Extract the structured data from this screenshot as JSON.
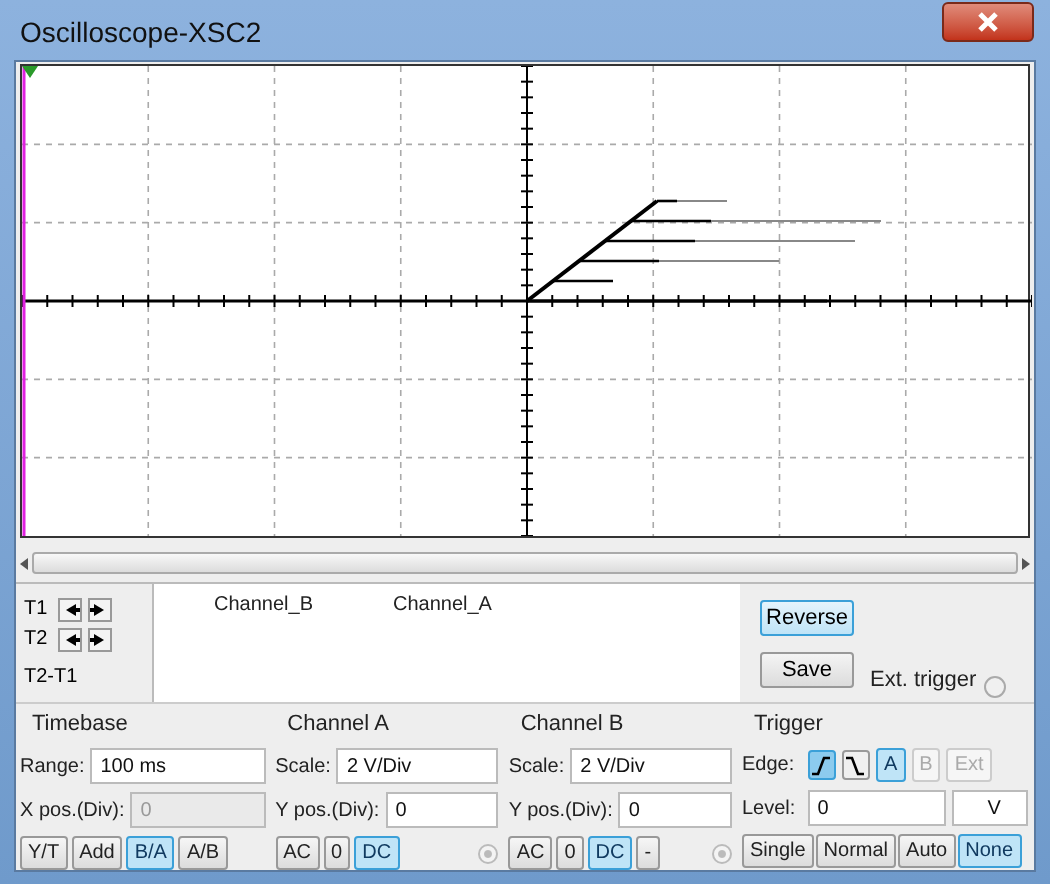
{
  "window": {
    "title": "Oscilloscope-XSC2"
  },
  "cursors": {
    "rows": [
      "T1",
      "T2",
      "T2-T1"
    ],
    "columns": [
      "Channel_B",
      "Channel_A"
    ]
  },
  "actions": [
    {
      "label": "Reverse",
      "selected": true
    },
    {
      "label": "Save",
      "selected": false
    }
  ],
  "ext_trigger": {
    "label": "Ext. trigger",
    "checked": false
  },
  "timebase": {
    "title": "Timebase",
    "range_label": "Range:",
    "range": "100 ms",
    "xpos_label": "X pos.(Div):",
    "xpos": "0",
    "xpos_disabled": true,
    "modes": [
      {
        "label": "Y/T",
        "selected": false
      },
      {
        "label": "Add",
        "selected": false
      },
      {
        "label": "B/A",
        "selected": true
      },
      {
        "label": "A/B",
        "selected": false
      }
    ]
  },
  "channels": [
    {
      "title": "Channel A",
      "scale_label": "Scale:",
      "scale": "2  V/Div",
      "ypos_label": "Y pos.(Div):",
      "ypos": "0",
      "coupling": [
        {
          "label": "AC",
          "selected": false
        },
        {
          "label": "0",
          "selected": false
        },
        {
          "label": "DC",
          "selected": true
        }
      ]
    },
    {
      "title": "Channel B",
      "scale_label": "Scale:",
      "scale": "2  V/Div",
      "ypos_label": "Y pos.(Div):",
      "ypos": "0",
      "coupling": [
        {
          "label": "AC",
          "selected": false
        },
        {
          "label": "0",
          "selected": false
        },
        {
          "label": "DC",
          "selected": true
        },
        {
          "label": "-",
          "selected": false
        }
      ]
    }
  ],
  "trigger": {
    "title": "Trigger",
    "edge_label": "Edge:",
    "edges": [
      {
        "kind": "rising",
        "selected": true
      },
      {
        "kind": "falling",
        "selected": false
      }
    ],
    "sources": [
      {
        "label": "A",
        "selected": true,
        "disabled": false
      },
      {
        "label": "B",
        "selected": false,
        "disabled": true
      },
      {
        "label": "Ext",
        "selected": false,
        "disabled": true
      }
    ],
    "level_label": "Level:",
    "level_value": "0",
    "level_unit": "V",
    "modes": [
      {
        "label": "Single",
        "selected": false
      },
      {
        "label": "Normal",
        "selected": false
      },
      {
        "label": "Auto",
        "selected": false
      },
      {
        "label": "None",
        "selected": true
      }
    ]
  }
}
